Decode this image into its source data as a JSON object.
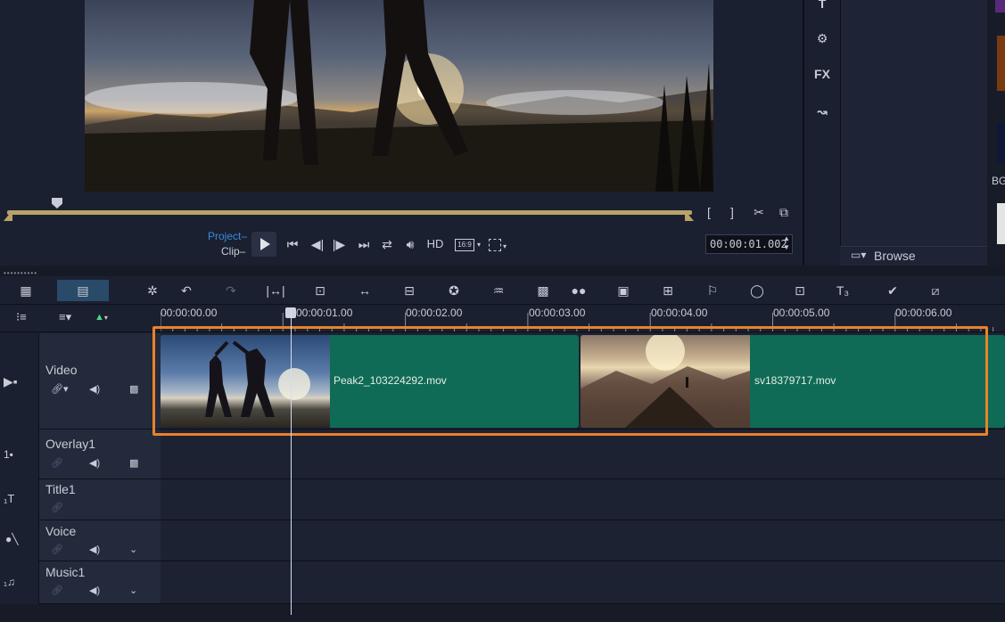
{
  "preview": {
    "mode_project": "Project",
    "mode_clip": "Clip",
    "timecode": "00:00:01.002",
    "hd_label": "HD",
    "aspect_label": "16:9"
  },
  "side_panel": {
    "fx_label": "FX",
    "browse_label": "Browse",
    "bg_label": "BG"
  },
  "ruler": {
    "labels": [
      "00:00:00.00",
      "00:00:01.00",
      "00:00:02.00",
      "00:00:03.00",
      "00:00:04.00",
      "00:00:05.00",
      "00:00:06.00"
    ]
  },
  "tracks": [
    {
      "name": "Video"
    },
    {
      "name": "Overlay1"
    },
    {
      "name": "Title1"
    },
    {
      "name": "Voice"
    },
    {
      "name": "Music1"
    }
  ],
  "clips": [
    {
      "label": "Peak2_103224292.mov"
    },
    {
      "label": "sv18379717.mov"
    }
  ],
  "colors": {
    "accent": "#e8832a",
    "clip": "#0f6b55",
    "background": "#1a1f2e"
  },
  "icons": [
    "film-icon",
    "storyboard-icon",
    "tools-icon",
    "undo-icon",
    "redo-icon",
    "fit-icon",
    "fx-icon",
    "scissors-icon",
    "play-icon"
  ]
}
